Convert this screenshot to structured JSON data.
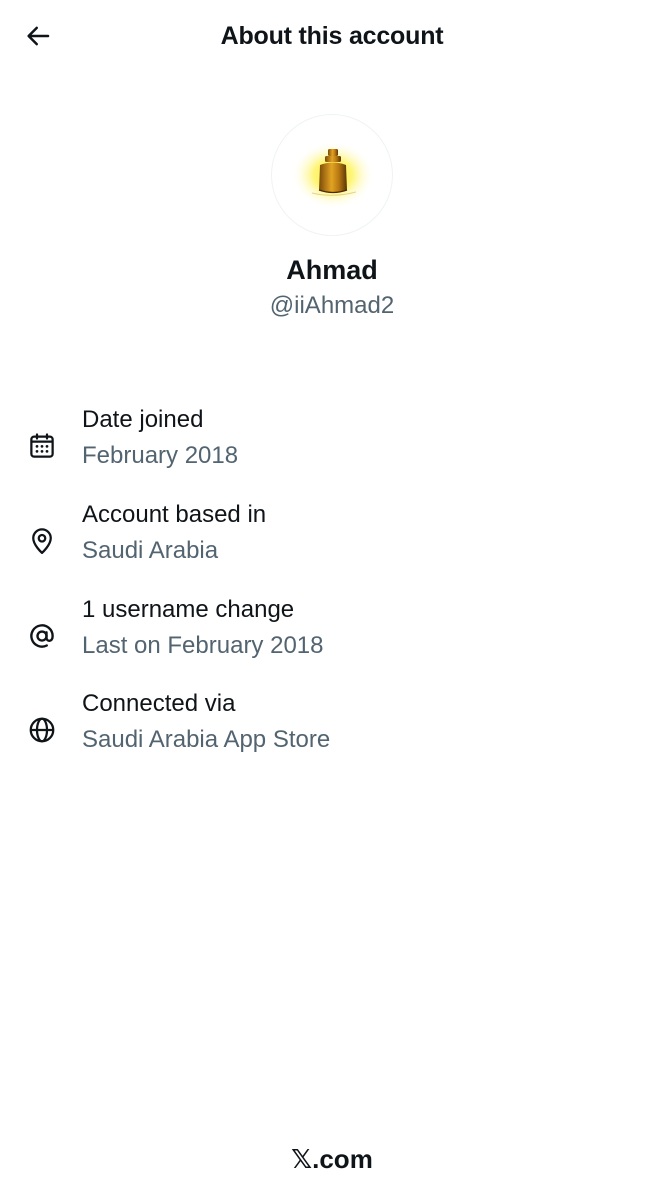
{
  "header": {
    "title": "About this account",
    "back_icon": "arrow-left-icon"
  },
  "profile": {
    "display_name": "Ahmad",
    "handle": "@iiAhmad2",
    "avatar": "golden-weight-avatar"
  },
  "info": {
    "date_joined": {
      "icon": "calendar-icon",
      "title": "Date joined",
      "value": "February 2018"
    },
    "location": {
      "icon": "location-pin-icon",
      "title": "Account based in",
      "value": "Saudi Arabia"
    },
    "username_changes": {
      "icon": "at-sign-icon",
      "title": "1 username change",
      "value": "Last on February 2018"
    },
    "connected_via": {
      "icon": "globe-icon",
      "title": "Connected via",
      "value": "Saudi Arabia App Store"
    }
  },
  "footer": {
    "x_glyph": "𝕏",
    "domain": ".com"
  },
  "colors": {
    "text_primary": "#0f1419",
    "text_secondary": "#536471",
    "background": "#ffffff"
  }
}
